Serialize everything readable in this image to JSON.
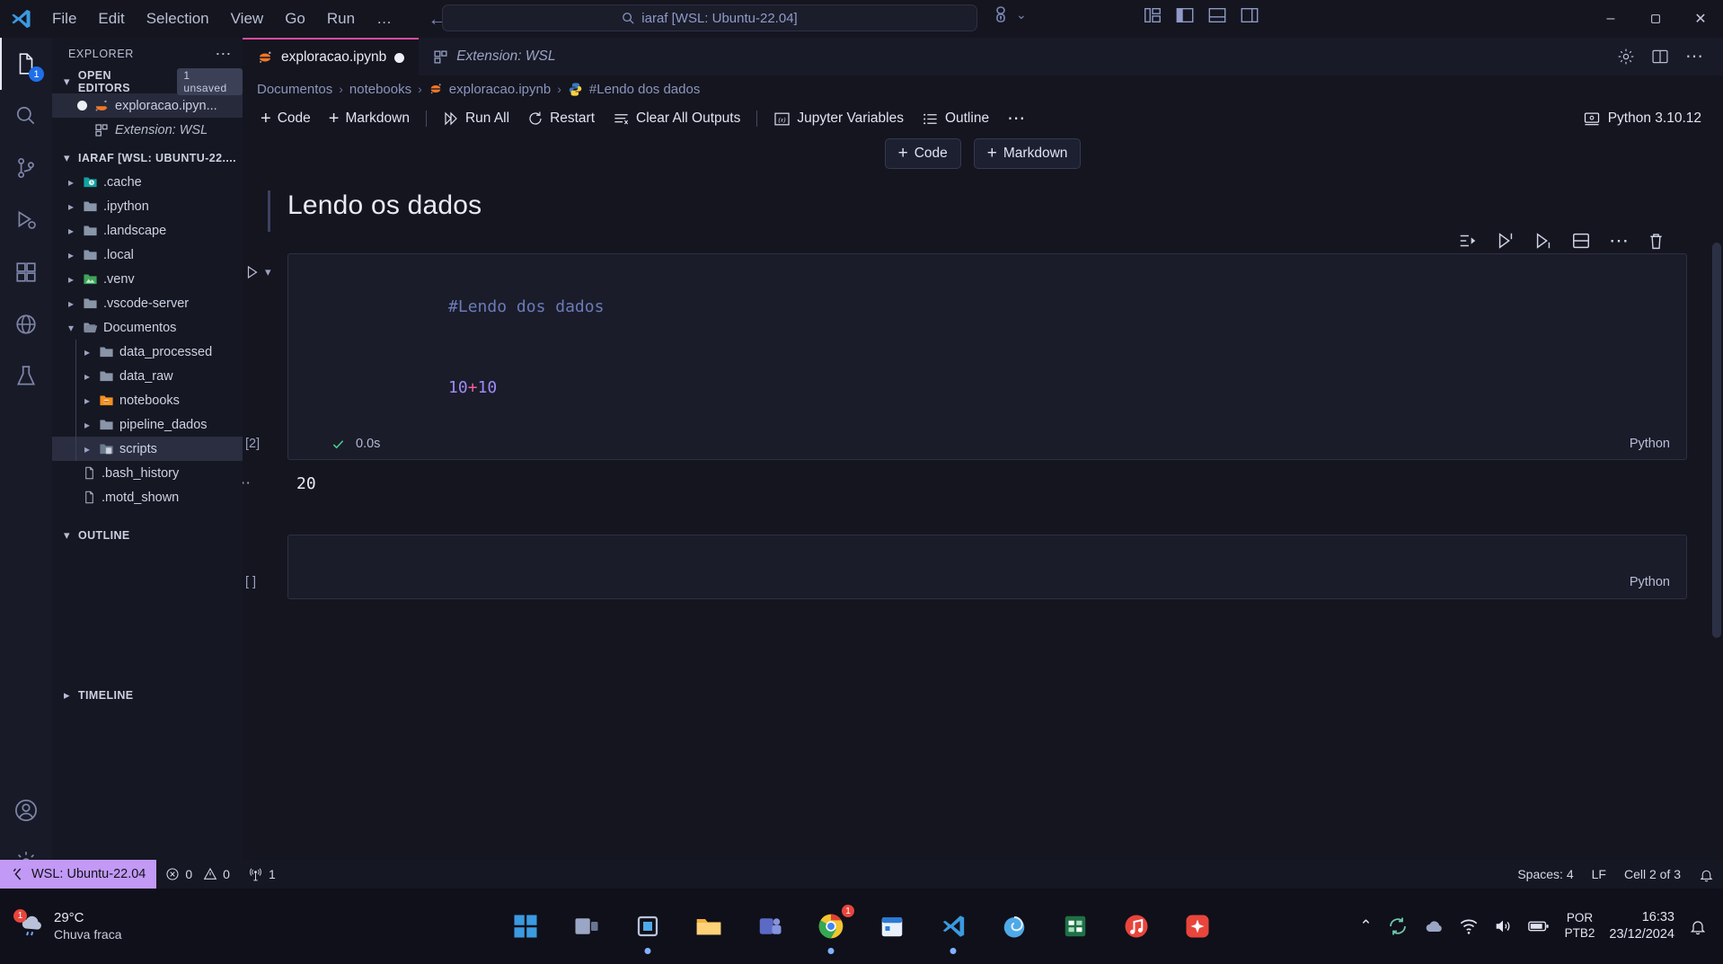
{
  "titlebar": {
    "menus": [
      "File",
      "Edit",
      "Selection",
      "View",
      "Go",
      "Run",
      "…"
    ],
    "nav_back": "←",
    "nav_forward": "→",
    "search_value": "iaraf [WSL: Ubuntu-22.04]",
    "search_icon": "search-icon",
    "remote_icon": "remote-explorer-icon",
    "remote_chevron": "⌄",
    "layout_icons": [
      "customize-layout-icon",
      "toggle-primary-sidebar-icon",
      "toggle-panel-icon",
      "toggle-secondary-sidebar-icon"
    ],
    "minimize": "–",
    "maximize": "❐",
    "close": "✕"
  },
  "activitybar": {
    "items": [
      {
        "name": "explorer",
        "icon": "files-icon",
        "badge": "1"
      },
      {
        "name": "search",
        "icon": "search-icon",
        "badge": ""
      },
      {
        "name": "source-control",
        "icon": "source-control-icon",
        "badge": ""
      },
      {
        "name": "run-debug",
        "icon": "run-debug-icon",
        "badge": ""
      },
      {
        "name": "extensions",
        "icon": "extensions-icon",
        "badge": ""
      },
      {
        "name": "remote-explorer",
        "icon": "remote-explorer-icon",
        "badge": ""
      },
      {
        "name": "testing",
        "icon": "beaker-icon",
        "badge": ""
      }
    ],
    "bottom": [
      {
        "name": "accounts",
        "icon": "account-icon"
      },
      {
        "name": "settings",
        "icon": "gear-icon"
      }
    ]
  },
  "sidebar": {
    "title": "EXPLORER",
    "more_actions": "⋯",
    "open_editors": {
      "label": "OPEN EDITORS",
      "badge": "1 unsaved",
      "items": [
        {
          "label": "exploracao.ipyn...",
          "icon": "jupyter-icon",
          "dirty": true,
          "selected": true
        },
        {
          "label": "Extension: WSL",
          "icon": "extensions-icon",
          "dirty": false,
          "selected": false
        }
      ]
    },
    "workspace": {
      "label": "IARAF [WSL: UBUNTU-22....",
      "items": [
        {
          "label": ".cache",
          "icon": "folder-cache-icon",
          "depth": 1,
          "expanded": false,
          "selected": false
        },
        {
          "label": ".ipython",
          "icon": "folder-icon",
          "depth": 1,
          "expanded": false,
          "selected": false
        },
        {
          "label": ".landscape",
          "icon": "folder-icon",
          "depth": 1,
          "expanded": false,
          "selected": false
        },
        {
          "label": ".local",
          "icon": "folder-icon",
          "depth": 1,
          "expanded": false,
          "selected": false
        },
        {
          "label": ".venv",
          "icon": "folder-venv-icon",
          "depth": 1,
          "expanded": false,
          "selected": false
        },
        {
          "label": ".vscode-server",
          "icon": "folder-icon",
          "depth": 1,
          "expanded": false,
          "selected": false
        },
        {
          "label": "Documentos",
          "icon": "folder-open-icon",
          "depth": 1,
          "expanded": true,
          "selected": false
        },
        {
          "label": "data_processed",
          "icon": "folder-icon",
          "depth": 2,
          "expanded": false,
          "selected": false
        },
        {
          "label": "data_raw",
          "icon": "folder-icon",
          "depth": 2,
          "expanded": false,
          "selected": false
        },
        {
          "label": "notebooks",
          "icon": "folder-notebook-icon",
          "depth": 2,
          "expanded": false,
          "selected": false
        },
        {
          "label": "pipeline_dados",
          "icon": "folder-icon",
          "depth": 2,
          "expanded": false,
          "selected": false
        },
        {
          "label": "scripts",
          "icon": "folder-scripts-icon",
          "depth": 2,
          "expanded": false,
          "selected": true
        },
        {
          "label": ".bash_history",
          "icon": "file-icon",
          "depth": 1,
          "expanded": null,
          "selected": false
        },
        {
          "label": ".motd_shown",
          "icon": "file-icon",
          "depth": 1,
          "expanded": null,
          "selected": false
        }
      ]
    },
    "outline": {
      "label": "OUTLINE"
    },
    "timeline": {
      "label": "TIMELINE"
    }
  },
  "editor": {
    "tabs": [
      {
        "label": "exploracao.ipynb",
        "icon": "jupyter-icon",
        "active": true,
        "dirty": true,
        "italic": false
      },
      {
        "label": "Extension: WSL",
        "icon": "extensions-icon",
        "active": false,
        "dirty": false,
        "italic": true
      }
    ],
    "tab_actions": [
      "gear-icon",
      "split-editor-icon",
      "more-actions-icon"
    ],
    "breadcrumb": [
      {
        "label": "Documentos",
        "icon": ""
      },
      {
        "label": "notebooks",
        "icon": ""
      },
      {
        "label": "exploracao.ipynb",
        "icon": "jupyter-icon"
      },
      {
        "label": "#Lendo dos dados",
        "icon": "python-icon"
      }
    ],
    "breadcrumb_separator": "›"
  },
  "notebook_toolbar": {
    "buttons": [
      {
        "label": "Code",
        "icon": "plus-icon"
      },
      {
        "label": "Markdown",
        "icon": "plus-icon"
      },
      {
        "label": "Run All",
        "icon": "run-all-icon"
      },
      {
        "label": "Restart",
        "icon": "restart-icon"
      },
      {
        "label": "Clear All Outputs",
        "icon": "clear-outputs-icon"
      },
      {
        "label": "Jupyter Variables",
        "icon": "variables-icon"
      },
      {
        "label": "Outline",
        "icon": "outline-icon"
      }
    ],
    "more": "⋯",
    "kernel": {
      "label": "Python 3.10.12",
      "icon": "kernel-icon"
    }
  },
  "notebook": {
    "add_buttons": [
      {
        "label": "Code",
        "icon": "plus-icon"
      },
      {
        "label": "Markdown",
        "icon": "plus-icon"
      }
    ],
    "cells": [
      {
        "type": "markdown",
        "heading": "Lendo os dados"
      },
      {
        "type": "code",
        "run_icon": "run-cell-icon",
        "collapse_icon": "chevron-down-icon",
        "exec_count": "[2]",
        "status_icon": "check-icon",
        "duration": "0.0s",
        "language": "Python",
        "source_lines": [
          {
            "tokens": [
              {
                "text": "#Lendo dos dados",
                "cls": "cm"
              }
            ]
          },
          {
            "tokens": [
              {
                "text": "10",
                "cls": "num"
              },
              {
                "text": "+",
                "cls": "op"
              },
              {
                "text": "10",
                "cls": "num"
              }
            ]
          }
        ],
        "output_dots": "⋯",
        "output": "20",
        "toolbar_icons": [
          "run-by-line-icon",
          "execute-above-icon",
          "execute-below-icon",
          "split-cell-icon",
          "more-actions-icon",
          "delete-cell-icon"
        ]
      },
      {
        "type": "code",
        "exec_count": "[ ]",
        "language": "Python",
        "source_lines": []
      }
    ]
  },
  "statusbar": {
    "remote": {
      "label": "WSL: Ubuntu-22.04",
      "icon": "remote-icon",
      "color": "#c299f5"
    },
    "problems": [
      {
        "icon": "error-icon",
        "value": "0"
      },
      {
        "icon": "warning-icon",
        "value": "0"
      }
    ],
    "ports": {
      "icon": "radio-tower-icon",
      "value": "1"
    },
    "right": [
      {
        "name": "indentation",
        "label": "Spaces: 4"
      },
      {
        "name": "eol",
        "label": "LF"
      },
      {
        "name": "cell-position",
        "label": "Cell 2 of 3"
      },
      {
        "name": "notifications",
        "label": "",
        "icon": "bell-icon"
      }
    ]
  },
  "taskbar": {
    "weather": {
      "temp": "29°C",
      "condition": "Chuva fraca",
      "icon": "rain-icon",
      "badge": "1"
    },
    "apps": [
      {
        "name": "start-windows",
        "icon": "windows-icon",
        "running": false
      },
      {
        "name": "task-view",
        "icon": "task-view-icon",
        "running": false
      },
      {
        "name": "snipping-tool",
        "icon": "snipping-tool-icon",
        "running": true
      },
      {
        "name": "file-explorer",
        "icon": "file-explorer-icon",
        "running": false
      },
      {
        "name": "teams",
        "icon": "teams-icon",
        "running": false
      },
      {
        "name": "chrome",
        "icon": "chrome-icon",
        "running": true,
        "badge": "1"
      },
      {
        "name": "calendar",
        "icon": "calendar-icon",
        "running": false
      },
      {
        "name": "vscode",
        "icon": "vscode-icon",
        "running": true
      },
      {
        "name": "firefox",
        "icon": "firefox-icon",
        "running": false
      },
      {
        "name": "excel",
        "icon": "excel-icon",
        "running": false
      },
      {
        "name": "music",
        "icon": "music-icon",
        "running": false
      },
      {
        "name": "app-extra",
        "icon": "sparkle-icon",
        "running": false
      }
    ],
    "tray": {
      "chevron": "⌃",
      "icons": [
        "sync-icon",
        "cloud-icon",
        "wifi-icon",
        "volume-icon",
        "battery-icon"
      ],
      "language": {
        "line1": "POR",
        "line2": "PTB2"
      },
      "time": "16:33",
      "date": "23/12/2024"
    }
  },
  "colors": {
    "accent_pink": "#d84ba0",
    "wsl_purple": "#c299f5",
    "bg": "#14151f",
    "panel": "#181a27"
  }
}
